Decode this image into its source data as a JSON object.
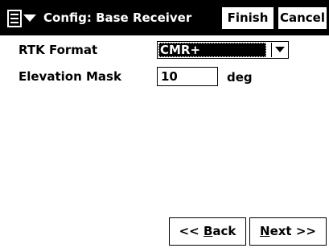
{
  "titlebar": {
    "title": "Config: Base Receiver",
    "menu_icon": "menu-list-icon",
    "finish_label": "Finish",
    "cancel_label": "Cancel"
  },
  "form": {
    "rtk_format_label": "RTK Format",
    "rtk_format_value": "CMR+",
    "elevation_mask_label": "Elevation Mask",
    "elevation_mask_value": "10",
    "elevation_mask_unit": "deg"
  },
  "footer": {
    "back_prefix": "<< ",
    "back_hotkey": "B",
    "back_rest": "ack",
    "next_hotkey": "N",
    "next_rest": "ext >>"
  }
}
